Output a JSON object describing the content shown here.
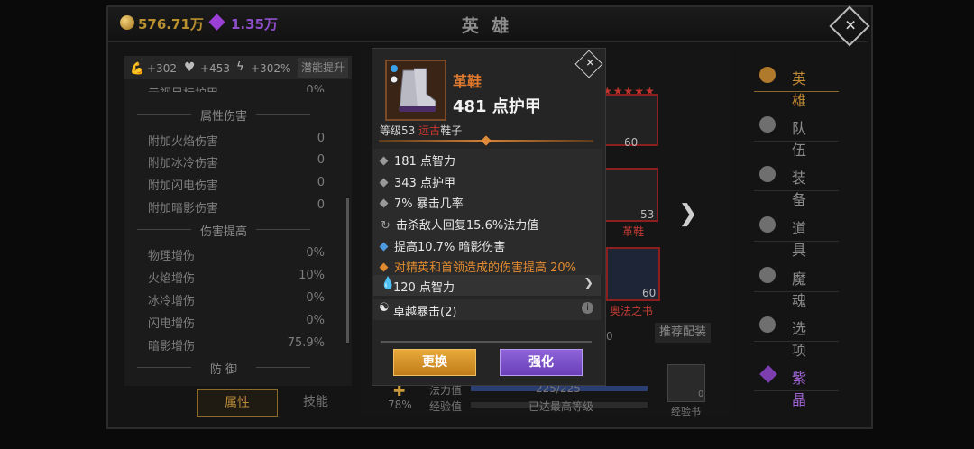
{
  "header": {
    "gold": "576.71万",
    "gems": "1.35万",
    "title": "英 雄"
  },
  "left": {
    "stats": [
      "+302",
      "+453",
      "+302%"
    ],
    "potential_btn": "潜能提升",
    "cut_row": {
      "label": "元视目标护甲",
      "value": "0%"
    },
    "sections": [
      {
        "title": "属性伤害",
        "rows": [
          {
            "label": "附加火焰伤害",
            "value": "0"
          },
          {
            "label": "附加冰冷伤害",
            "value": "0"
          },
          {
            "label": "附加闪电伤害",
            "value": "0"
          },
          {
            "label": "附加暗影伤害",
            "value": "0"
          }
        ]
      },
      {
        "title": "伤害提高",
        "rows": [
          {
            "label": "物理增伤",
            "value": "0%"
          },
          {
            "label": "火焰增伤",
            "value": "10%"
          },
          {
            "label": "冰冷增伤",
            "value": "0%"
          },
          {
            "label": "闪电增伤",
            "value": "0%"
          },
          {
            "label": "暗影增伤",
            "value": "75.9%"
          }
        ]
      },
      {
        "title": "防 御",
        "rows": []
      }
    ],
    "tabs": [
      "属性",
      "技能"
    ]
  },
  "background": {
    "slot_num_top": "60",
    "slot_num_shoes": "53",
    "slot_label_shoes": "革鞋",
    "slot_num_book": "60",
    "slot_label_book": "奥法之书",
    "rec_btn": "推荐配装",
    "mana_label": "法力值",
    "mana_value": "225/225",
    "exp_label": "经验值",
    "exp_value": "已达最高等级",
    "pct": "78%",
    "exp_book": "经验书",
    "exp_book_count": "0",
    "partial_num": "0"
  },
  "nav": [
    "英 雄",
    "队 伍",
    "装 备",
    "道 具",
    "魔 魂",
    "选 项",
    "紫 晶"
  ],
  "modal": {
    "name": "革鞋",
    "armor": "481 点护甲",
    "level_prefix": "等级53 ",
    "level_tag": "远古",
    "level_suffix": "鞋子",
    "stats": [
      "181 点智力",
      "343 点护甲",
      "7% 暴击几率",
      "击杀敌人回复15.6%法力值",
      "提高10.7% 暗影伤害",
      "对精英和首领造成的伤害提高 20%"
    ],
    "gem_row": "120 点智力",
    "set_row": "卓越暴击(2)",
    "btn_replace": "更换",
    "btn_upgrade": "强化"
  },
  "colors": {
    "gold": "#c89a3a",
    "purple": "#8d4fc9",
    "orange": "#e07a2f",
    "red": "#c23b34",
    "btn_gold": "#d99a2b",
    "btn_purple": "#7d54c8"
  }
}
